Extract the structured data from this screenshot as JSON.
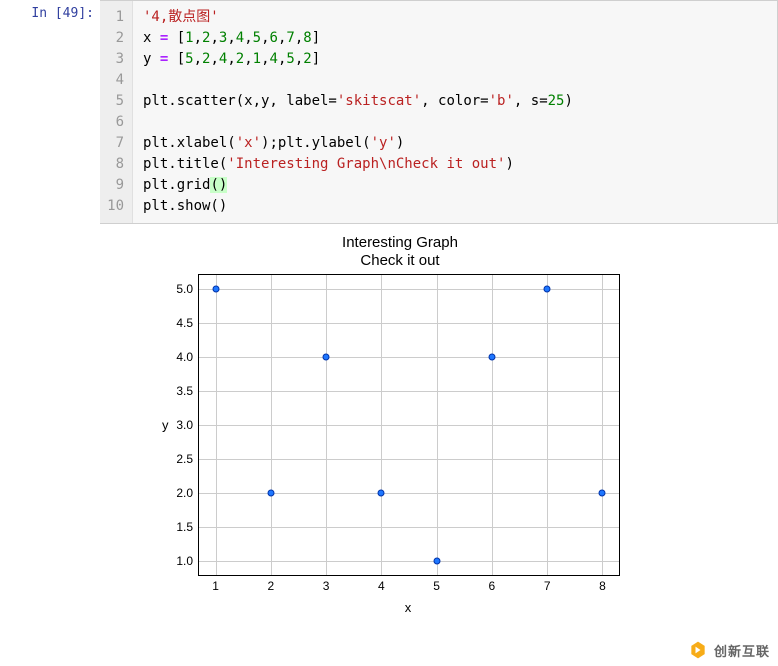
{
  "prompt": {
    "label": "In [49]:"
  },
  "code": {
    "gutter": [
      "1",
      "2",
      "3",
      "4",
      "5",
      "6",
      "7",
      "8",
      "9",
      "10"
    ],
    "l1_str": "'4,散点图'",
    "l2_a": "x ",
    "l2_eq": "=",
    "l2_b": " [",
    "l2_nums": [
      "1",
      "2",
      "3",
      "4",
      "5",
      "6",
      "7",
      "8"
    ],
    "l2_c": "]",
    "l3_a": "y ",
    "l3_eq": "=",
    "l3_b": " [",
    "l3_nums": [
      "5",
      "2",
      "4",
      "2",
      "1",
      "4",
      "5",
      "2"
    ],
    "l3_c": "]",
    "l5_a": "plt.scatter(x,y, label=",
    "l5_s1": "'skitscat'",
    "l5_b": ", color=",
    "l5_s2": "'b'",
    "l5_c": ", s=",
    "l5_n": "25",
    "l5_d": ")",
    "l7_a": "plt.xlabel(",
    "l7_s1": "'x'",
    "l7_b": ");plt.ylabel(",
    "l7_s2": "'y'",
    "l7_c": ")",
    "l8_a": "plt.title(",
    "l8_s1": "'Interesting Graph\\nCheck it out'",
    "l8_b": ")",
    "l9_a": "plt.grid",
    "l9_lp": "(",
    "l9_rp": ")",
    "l10_a": "plt.show()"
  },
  "chart_data": {
    "type": "scatter",
    "title_line1": "Interesting Graph",
    "title_line2": "Check it out",
    "xlabel": "x",
    "ylabel": "y",
    "xlim": [
      0.7,
      8.3
    ],
    "ylim": [
      0.8,
      5.2
    ],
    "xticks": [
      1,
      2,
      3,
      4,
      5,
      6,
      7,
      8
    ],
    "yticks": [
      1.0,
      1.5,
      2.0,
      2.5,
      3.0,
      3.5,
      4.0,
      4.5,
      5.0
    ],
    "yticklabels": [
      "1.0",
      "1.5",
      "2.0",
      "2.5",
      "3.0",
      "3.5",
      "4.0",
      "4.5",
      "5.0"
    ],
    "x": [
      1,
      2,
      3,
      4,
      5,
      6,
      7,
      8
    ],
    "y": [
      5,
      2,
      4,
      2,
      1,
      4,
      5,
      2
    ],
    "color": "#1f77ff",
    "grid": true
  },
  "watermark": {
    "text": "创新互联"
  }
}
